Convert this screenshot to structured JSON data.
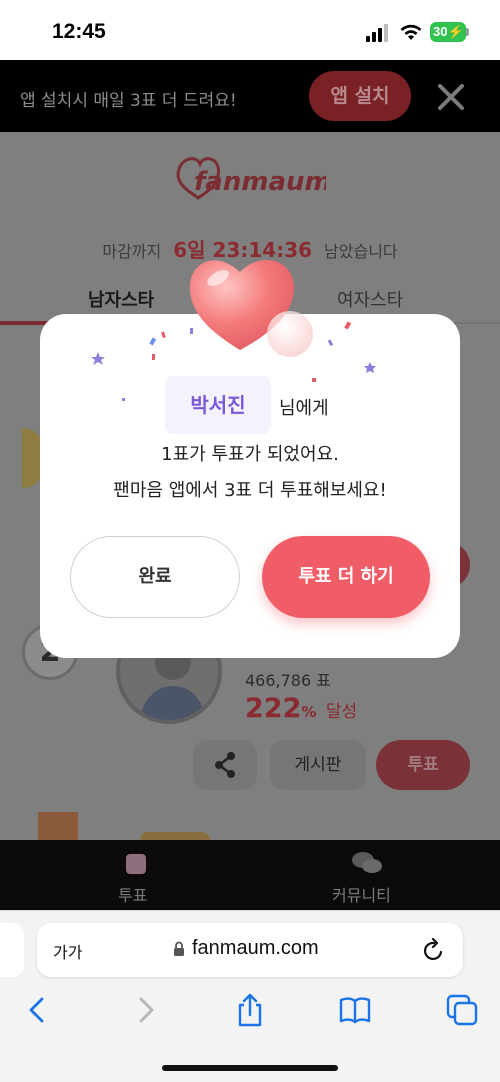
{
  "status_bar": {
    "time": "12:45",
    "battery": "30"
  },
  "banner": {
    "text": "앱 설치시 매일 3표 더 드려요!",
    "install_label": "앱 설치"
  },
  "page": {
    "logo_text": "fanmaum",
    "deadline_prefix": "마감까지",
    "countdown": "6일 23:14:36",
    "deadline_suffix": "남았습니다",
    "tabs": [
      "남자스타",
      "여자스타"
    ],
    "rank": "2",
    "votes": "466,786 표",
    "percent": "222",
    "percent_unit": "%",
    "percent_label": "달성",
    "board_label": "게시판",
    "vote_label": "투표"
  },
  "tabbar": {
    "vote": "투표",
    "community": "커뮤니티"
  },
  "modal": {
    "name": "박서진",
    "name_suffix": "님에게",
    "line1": "1표가 투표가 되었어요.",
    "line2": "팬마음 앱에서 3표 더 투표해보세요!",
    "done_label": "완료",
    "more_label": "투표 더 하기"
  },
  "safari": {
    "aa": "가가",
    "url": "fanmaum.com"
  },
  "colors": {
    "accent": "#f05d67",
    "name": "#7a58d8"
  }
}
